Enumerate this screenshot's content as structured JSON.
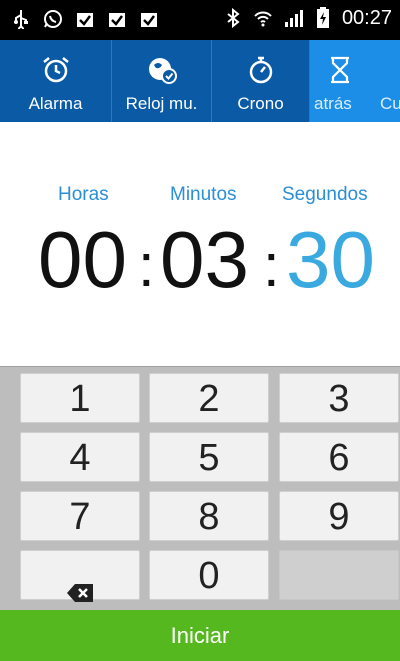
{
  "status_bar": {
    "time": "00:27",
    "left_icons": [
      "usb-icon",
      "whatsapp-icon",
      "clipboard-check-icon",
      "clipboard-check-icon",
      "clipboard-check-icon"
    ],
    "right_icons": [
      "bluetooth-icon",
      "wifi-icon",
      "signal-icon",
      "battery-charging-icon"
    ]
  },
  "tabs": [
    {
      "label": "Alarma",
      "icon": "alarm-clock-icon"
    },
    {
      "label": "Reloj mu.",
      "icon": "world-clock-icon"
    },
    {
      "label": "Crono",
      "icon": "stopwatch-icon"
    },
    {
      "label": "atrás",
      "icon": "hourglass-icon",
      "active": true
    },
    {
      "label": "Cu"
    }
  ],
  "timer": {
    "labels": {
      "hours": "Horas",
      "minutes": "Minutos",
      "seconds": "Segundos"
    },
    "hours": "00",
    "minutes": "03",
    "seconds": "30",
    "separator": ":"
  },
  "keypad": {
    "keys": [
      "1",
      "2",
      "3",
      "4",
      "5",
      "6",
      "7",
      "8",
      "9",
      "⌫",
      "0",
      ""
    ]
  },
  "start_button": "Iniciar",
  "colors": {
    "tab_bar": "#0a5aa5",
    "active_tab": "#1d8ee8",
    "accent": "#3aa9df",
    "start_green": "#56b81f"
  }
}
